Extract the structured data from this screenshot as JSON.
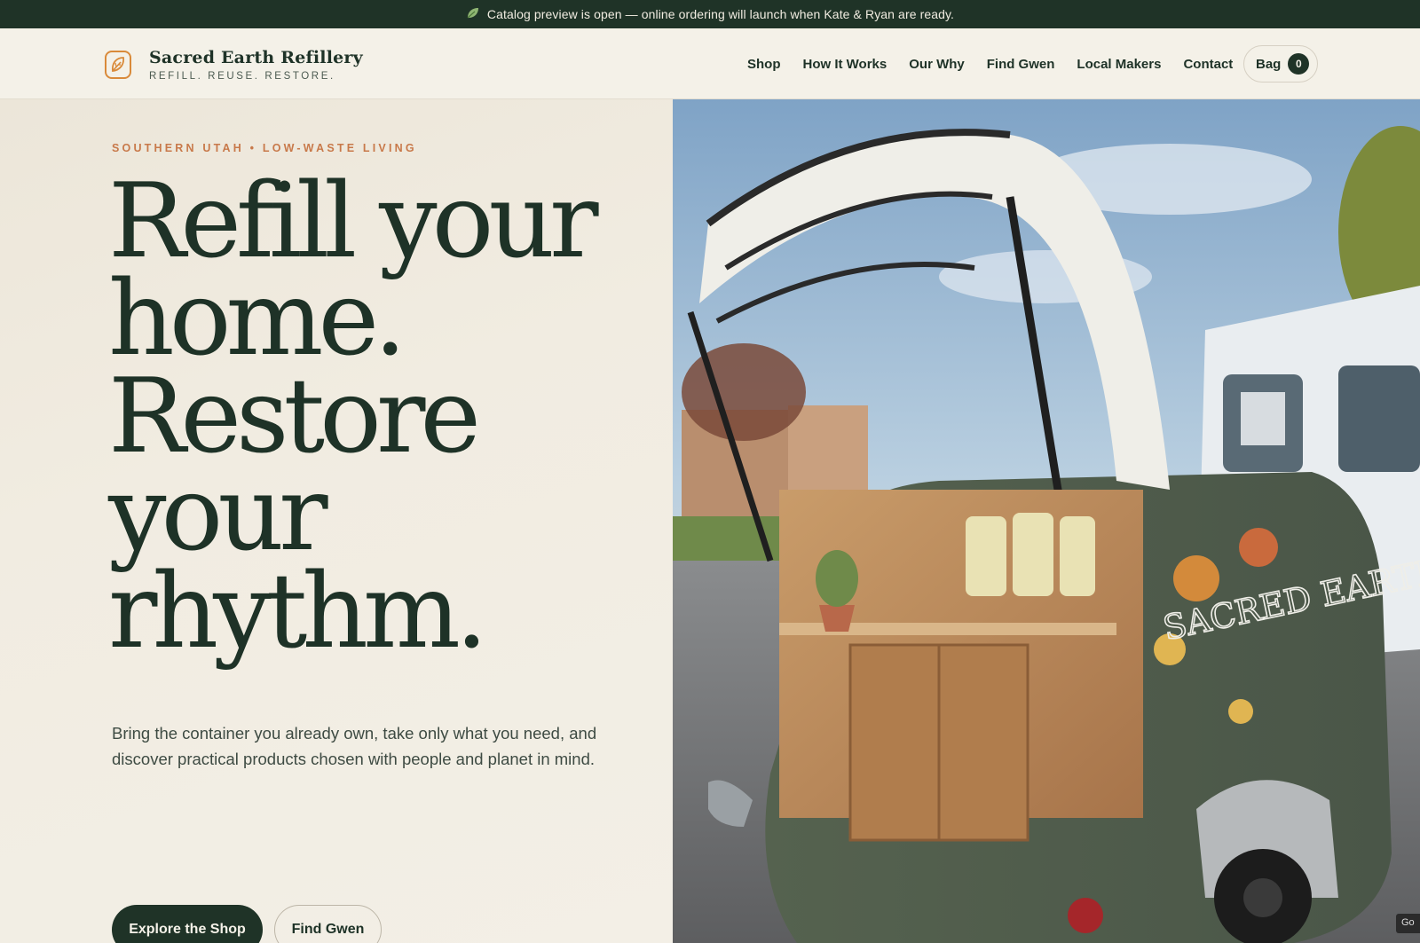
{
  "announcement": {
    "icon": "leaf-icon",
    "text": "Catalog preview is open — online ordering will launch when Kate & Ryan are ready."
  },
  "brand": {
    "name": "Sacred Earth Refillery",
    "tagline": "REFILL. REUSE. RESTORE.",
    "icon": "leaf-logo-icon",
    "accent_color": "#d98a3a"
  },
  "nav": {
    "items": [
      "Shop",
      "How It Works",
      "Our Why",
      "Find Gwen",
      "Local Makers",
      "Contact"
    ]
  },
  "bag": {
    "label": "Bag",
    "count": "0"
  },
  "hero": {
    "eyebrow": "SOUTHERN UTAH • LOW-WASTE LIVING",
    "headline_lines": [
      "Refill your",
      "home.",
      "Restore",
      "your",
      "rhythm."
    ],
    "lede": "Bring the container you already own, take only what you need, and discover practical products chosen with people and planet in mind.",
    "primary_cta": "Explore the Shop",
    "secondary_cta": "Find Gwen",
    "photo_label": "SACRED EARTH"
  },
  "corner_tag": "Go",
  "colors": {
    "dark_green": "#1f3327",
    "cream": "#f1ece1",
    "accent_orange": "#c8794a"
  }
}
